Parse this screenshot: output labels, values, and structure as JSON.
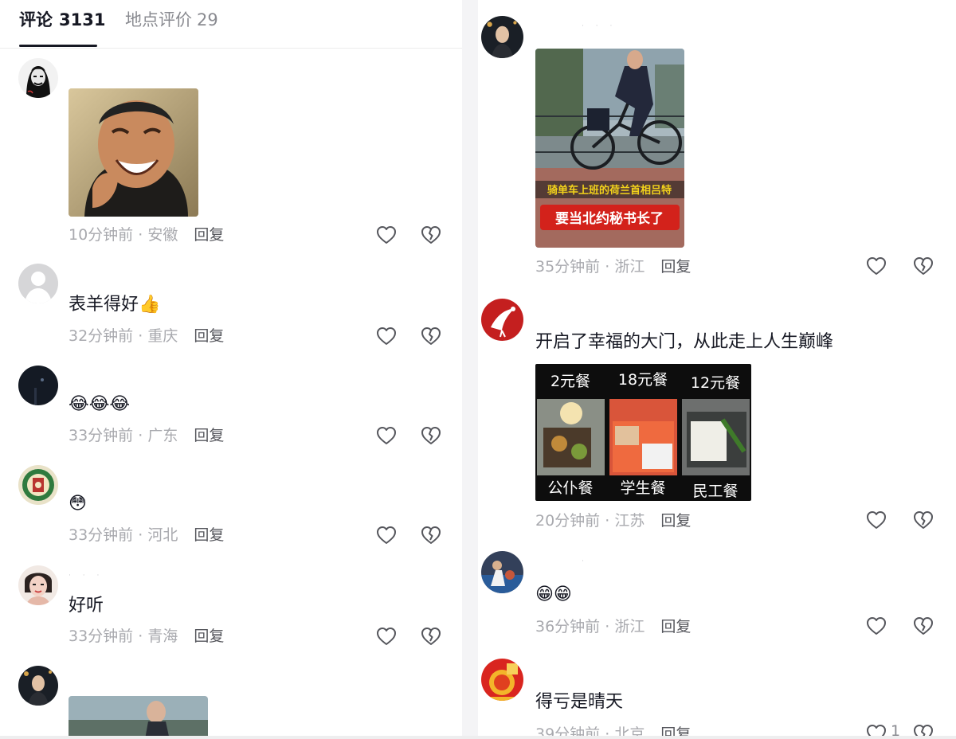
{
  "tabs": [
    {
      "label": "评论",
      "count": "3131",
      "active": true
    },
    {
      "label": "地点评价",
      "count": "29",
      "active": false
    }
  ],
  "left_comments": [
    {
      "avatar": "portrait-sketch",
      "text": "",
      "image": "laughing-man",
      "time": "10分钟前",
      "location": "安徽",
      "reply": "回复"
    },
    {
      "avatar": "default-gray",
      "text": "表羊得好👍",
      "time": "32分钟前",
      "location": "重庆",
      "reply": "回复"
    },
    {
      "avatar": "night-photo",
      "text": "😂😂😂",
      "time": "33分钟前",
      "location": "广东",
      "reply": "回复"
    },
    {
      "avatar": "green-emblem",
      "text": "😳",
      "time": "33分钟前",
      "location": "河北",
      "reply": "回复"
    },
    {
      "avatar": "woman-photo",
      "text": "好听",
      "time": "33分钟前",
      "location": "青海",
      "reply": "回复"
    },
    {
      "avatar": "man-photo",
      "text": "",
      "image": "cyclist-thumb"
    }
  ],
  "right_comments": [
    {
      "avatar": "man-photo",
      "image": "cyclist",
      "image_caption_top": "骑单车上班的荷兰首相吕特",
      "image_caption_bottom": "要当北约秘书长了",
      "time": "35分钟前",
      "location": "浙江",
      "reply": "回复"
    },
    {
      "avatar": "red-crane",
      "text": "开启了幸福的大门，从此走上人生巅峰",
      "image": "meal-grid",
      "meals": [
        "2元餐",
        "18元餐",
        "12元餐",
        "公仆餐",
        "学生餐",
        "民工餐"
      ],
      "time": "20分钟前",
      "location": "江苏",
      "reply": "回复"
    },
    {
      "avatar": "sports-photo",
      "text": "😁😁",
      "time": "36分钟前",
      "location": "浙江",
      "reply": "回复"
    },
    {
      "avatar": "fortune-red",
      "text": "得亏是晴天",
      "time": "39分钟前",
      "location": "北京",
      "reply": "回复",
      "likes": "1"
    }
  ],
  "colors": {
    "primary_text": "#161823",
    "secondary_text": "#a8a9ae",
    "reply_text": "#55565c",
    "divider": "#ececec"
  },
  "icons": [
    "heart-outline-icon",
    "broken-heart-icon"
  ]
}
